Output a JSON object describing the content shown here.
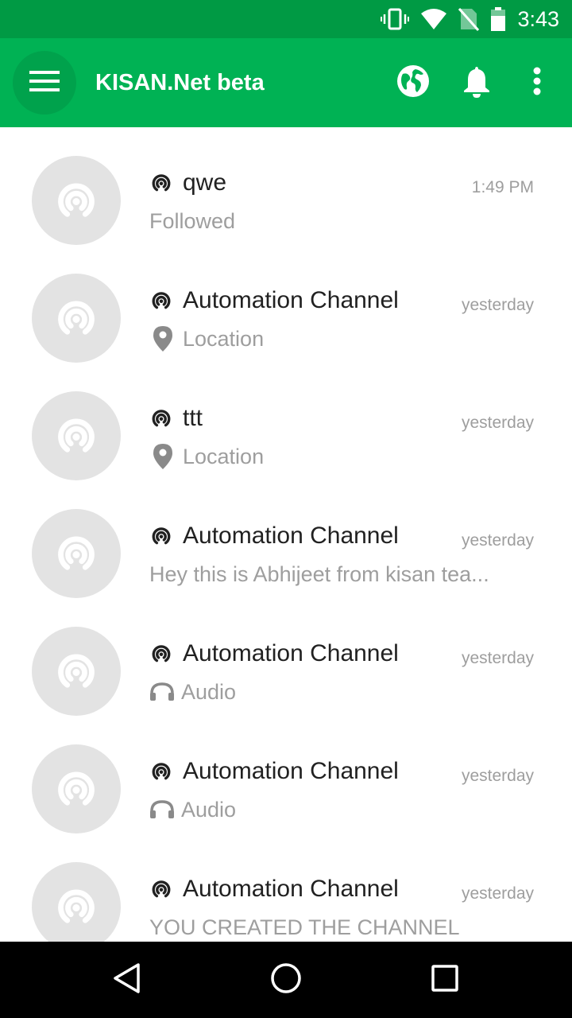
{
  "status_bar": {
    "time": "3:43",
    "icons": [
      "vibrate-icon",
      "wifi-icon",
      "no-sim-icon",
      "battery-icon"
    ]
  },
  "app_bar": {
    "title": "KISAN.Net beta",
    "menu_icon": "hamburger-menu-icon",
    "actions": [
      "globe-icon",
      "bell-icon",
      "more-vert-icon"
    ]
  },
  "colors": {
    "status_bar": "#009a44",
    "app_bar": "#00b254",
    "avatar_bg": "#e3e3e3",
    "title_text": "#212121",
    "secondary_text": "#9e9e9e"
  },
  "channels": [
    {
      "name": "qwe",
      "time": "1:49 PM",
      "subtitle": "Followed",
      "subtitle_icon": ""
    },
    {
      "name": "Automation Channel",
      "time": "yesterday",
      "subtitle": "Location",
      "subtitle_icon": "location-pin-icon"
    },
    {
      "name": "ttt",
      "time": "yesterday",
      "subtitle": "Location",
      "subtitle_icon": "location-pin-icon"
    },
    {
      "name": "Automation Channel",
      "time": "yesterday",
      "subtitle": "Hey this is Abhijeet from kisan tea...",
      "subtitle_icon": ""
    },
    {
      "name": "Automation Channel",
      "time": "yesterday",
      "subtitle": "Audio",
      "subtitle_icon": "headphones-icon"
    },
    {
      "name": "Automation Channel",
      "time": "yesterday",
      "subtitle": "Audio",
      "subtitle_icon": "headphones-icon"
    },
    {
      "name": "Automation Channel",
      "time": "yesterday",
      "subtitle": "YOU CREATED THE CHANNEL",
      "subtitle_icon": ""
    }
  ],
  "nav_bar": {
    "buttons": [
      "back-triangle-icon",
      "home-circle-icon",
      "recents-square-icon"
    ]
  }
}
